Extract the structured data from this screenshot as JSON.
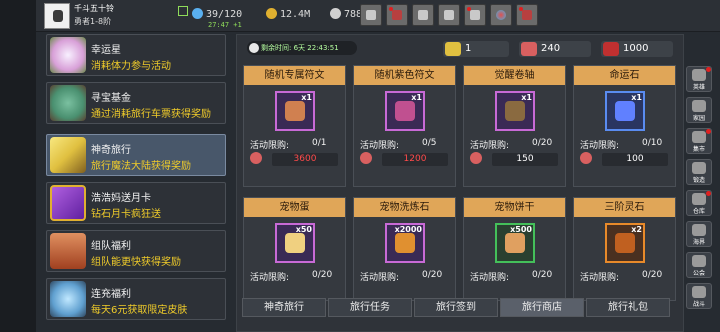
{
  "player": {
    "name": "千斗五十铃",
    "rank": "勇者1-8阶",
    "stamina": "39/120",
    "gold": "12.4M",
    "gems": "78871",
    "regen": "27:47 +1"
  },
  "left_menu": [
    {
      "title": "幸运星",
      "desc": "消耗体力参与活动",
      "icon": "star-icon",
      "color": "#d8a0d8"
    },
    {
      "title": "寻宝基金",
      "desc": "通过消耗旅行车票获得奖励",
      "icon": "treasure-bag-icon",
      "color": "#4a9070"
    },
    {
      "title": "神奇旅行",
      "desc": "旅行魔法大陆获得奖励",
      "icon": "ticket-icon",
      "color": "#e0c040",
      "active": true
    },
    {
      "title": "浩浩妈送月卡",
      "desc": "钻石月卡疯狂送",
      "icon": "card-icon",
      "color": "#8040c0"
    },
    {
      "title": "组队福利",
      "desc": "组队能更快获得奖励",
      "icon": "chest-icon",
      "color": "#c07040"
    },
    {
      "title": "连充福利",
      "desc": "每天6元获取限定皮肤",
      "icon": "crystal-icon",
      "color": "#60a0d0"
    }
  ],
  "timer": {
    "label": "剩余时间: 6天 22:43:51"
  },
  "currencies": [
    {
      "value": "1",
      "icon": "ticket-icon",
      "color": "#e0c040"
    },
    {
      "value": "240",
      "icon": "pouch-icon",
      "color": "#d86060"
    },
    {
      "value": "1000",
      "icon": "red-bag-icon",
      "color": "#c03030"
    }
  ],
  "shop_items": [
    {
      "title": "随机专属符文",
      "qty": "x1",
      "limit_label": "活动限购:",
      "limit": "0/1",
      "price": "3600",
      "price_red": true,
      "slot": "purple",
      "gem": "#d08050"
    },
    {
      "title": "随机紫色符文",
      "qty": "x1",
      "limit_label": "活动限购:",
      "limit": "0/5",
      "price": "1200",
      "price_red": true,
      "slot": "purple",
      "gem": "#c05090"
    },
    {
      "title": "觉醒卷轴",
      "qty": "x1",
      "limit_label": "活动限购:",
      "limit": "0/20",
      "price": "150",
      "price_red": false,
      "slot": "purple",
      "gem": "#8a6a40"
    },
    {
      "title": "命运石",
      "qty": "x1",
      "limit_label": "活动限购:",
      "limit": "0/10",
      "price": "100",
      "price_red": false,
      "slot": "blue",
      "gem": "#6080ff"
    },
    {
      "title": "宠物蛋",
      "qty": "x50",
      "limit_label": "活动限购:",
      "limit": "0/20",
      "slot": "purple",
      "gem": "#f0d080"
    },
    {
      "title": "宠物洗炼石",
      "qty": "x2000",
      "limit_label": "活动限购:",
      "limit": "0/20",
      "slot": "purple",
      "gem": "#e09030"
    },
    {
      "title": "宠物饼干",
      "qty": "x500",
      "limit_label": "活动限购:",
      "limit": "0/20",
      "slot": "green",
      "gem": "#e0a060"
    },
    {
      "title": "三阶灵石",
      "qty": "x2",
      "limit_label": "活动限购:",
      "limit": "0/20",
      "slot": "orange",
      "gem": "#c06020"
    }
  ],
  "tabs": [
    {
      "label": "神奇旅行"
    },
    {
      "label": "旅行任务"
    },
    {
      "label": "旅行签到"
    },
    {
      "label": "旅行商店",
      "active": true
    },
    {
      "label": "旅行礼包"
    }
  ],
  "right_nav": [
    {
      "label": "英雄",
      "icon": "hero-icon",
      "dot": true
    },
    {
      "label": "家园",
      "icon": "home-icon",
      "dot": false
    },
    {
      "label": "集市",
      "icon": "market-icon",
      "dot": true
    },
    {
      "label": "锻造",
      "icon": "anvil-icon",
      "dot": false
    },
    {
      "label": "仓库",
      "icon": "warehouse-icon",
      "dot": true
    },
    {
      "label": "海界",
      "icon": "sea-icon",
      "dot": false
    },
    {
      "label": "公会",
      "icon": "guild-icon",
      "dot": false
    },
    {
      "label": "战斗",
      "icon": "battle-icon",
      "dot": false
    }
  ]
}
